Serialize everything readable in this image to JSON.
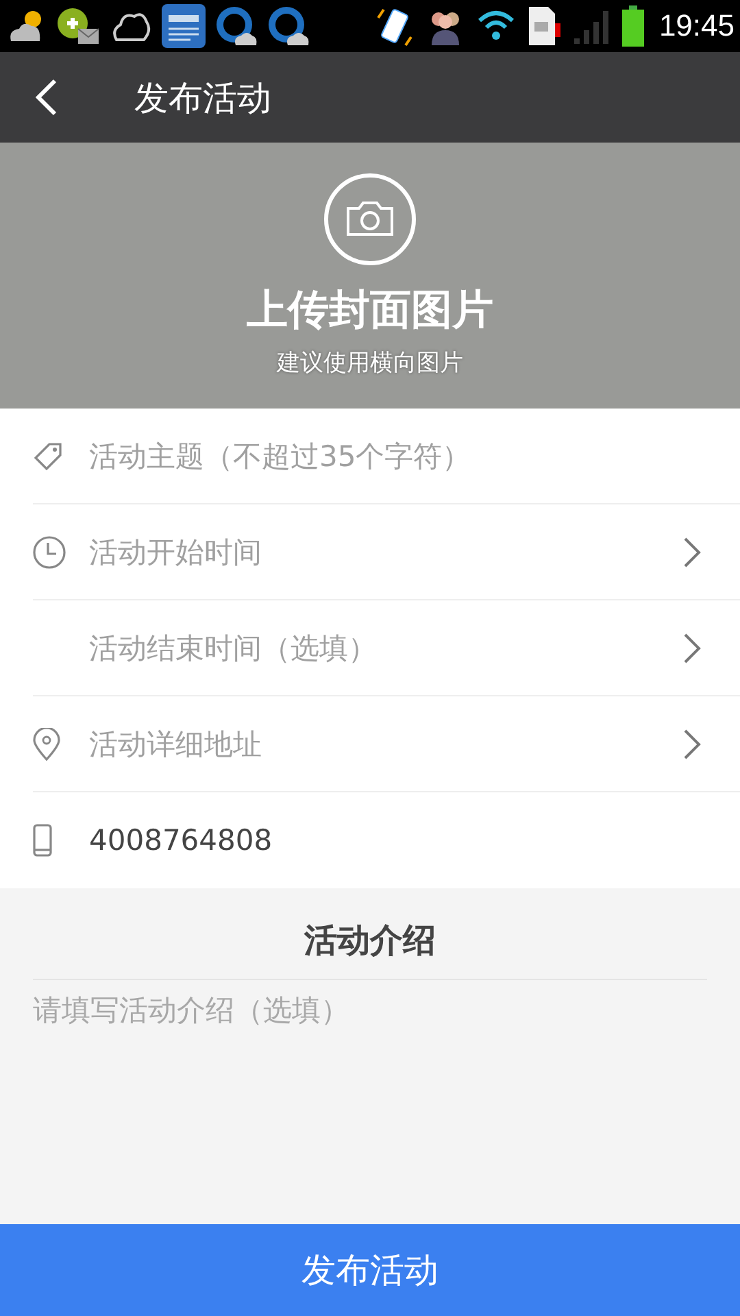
{
  "status_bar": {
    "time": "19:45"
  },
  "header": {
    "title": "发布活动"
  },
  "cover": {
    "title": "上传封面图片",
    "hint": "建议使用横向图片"
  },
  "fields": [
    {
      "kind": "tag",
      "placeholder": "活动主题（不超过35个字符）",
      "chevron": false
    },
    {
      "kind": "clock",
      "placeholder": "活动开始时间",
      "chevron": true
    },
    {
      "kind": "none",
      "placeholder": "活动结束时间（选填）",
      "chevron": true
    },
    {
      "kind": "pin",
      "placeholder": "活动详细地址",
      "chevron": true
    },
    {
      "kind": "phone",
      "value": "4008764808",
      "chevron": false
    }
  ],
  "intro": {
    "title": "活动介绍",
    "placeholder": "请填写活动介绍（选填）"
  },
  "submit": {
    "label": "发布活动"
  }
}
